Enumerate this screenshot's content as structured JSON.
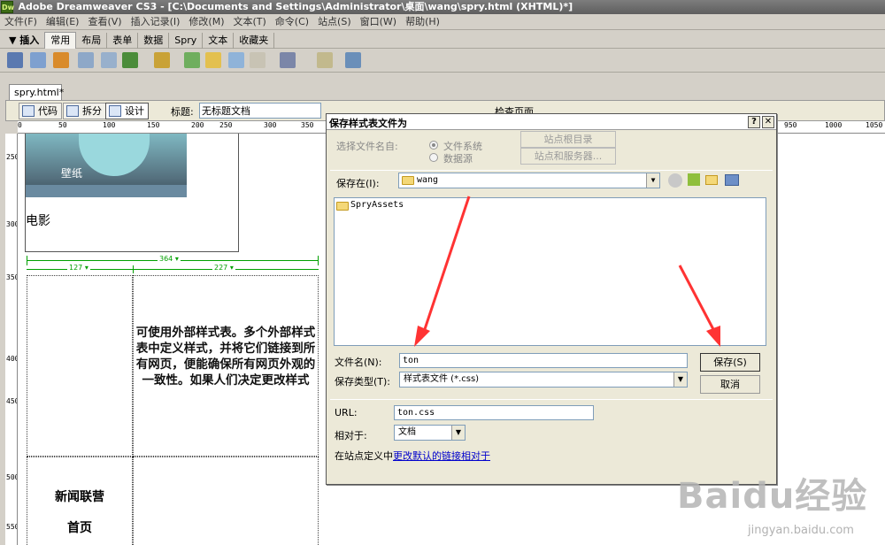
{
  "window": {
    "title": "Adobe Dreamweaver CS3 - [C:\\Documents and Settings\\Administrator\\桌面\\wang\\spry.html (XHTML)*]",
    "logo": "Dw"
  },
  "menu": [
    "文件(F)",
    "编辑(E)",
    "查看(V)",
    "插入记录(I)",
    "修改(M)",
    "文本(T)",
    "命令(C)",
    "站点(S)",
    "窗口(W)",
    "帮助(H)"
  ],
  "insert_bar": {
    "label": "▼ 插入",
    "tabs": [
      "常用",
      "布局",
      "表单",
      "数据",
      "Spry",
      "文本",
      "收藏夹"
    ],
    "active_tab": "常用"
  },
  "document": {
    "tab": "spry.html*",
    "toolbar": {
      "code": "代码",
      "split": "拆分",
      "design": "设计",
      "title_label": "标题:",
      "title_value": "无标题文档",
      "check_page": "检查页面"
    },
    "ruler_top": [
      "0",
      "50",
      "100",
      "150",
      "200",
      "250",
      "300",
      "350",
      "950",
      "1000",
      "1050"
    ],
    "ruler_left": [
      "250",
      "300",
      "350",
      "400",
      "450",
      "500",
      "550"
    ],
    "wallpaper": "壁纸",
    "movie": "电影",
    "table_width": "364 ▾",
    "col1_width": "127 ▾",
    "col2_width": "227 ▾",
    "cell_text": "可使用外部样式表。多个外部样式表中定义样式，并将它们链接到所有网页，便能确保所有网页外观的一致性。如果人们决定更改样式",
    "news": "新闻联营",
    "home": "首页"
  },
  "dialog": {
    "title": "保存样式表文件为",
    "help": "?",
    "close": "✕",
    "select_from_label": "选择文件名自:",
    "radio_filesystem": "文件系统",
    "radio_datasource": "数据源",
    "site_root_button": "站点根目录",
    "site_server_button": "站点和服务器...",
    "save_in_label": "保存在(I):",
    "save_in_value": "wang",
    "folders": [
      "SpryAssets"
    ],
    "filename_label": "文件名(N):",
    "filename_value": "ton",
    "filetype_label": "保存类型(T):",
    "filetype_value": "样式表文件 (*.css)",
    "save_button": "保存(S)",
    "cancel_button": "取消",
    "url_label": "URL:",
    "url_value": "ton.css",
    "relative_label": "相对于:",
    "relative_value": "文档",
    "site_def_text": "在站点定义中",
    "site_def_link": "更改默认的链接相对于"
  },
  "watermark": {
    "logo": "Baidu经验",
    "url": "jingyan.baidu.com"
  },
  "colors": {
    "annotation_arrow": "#ff3333",
    "width_guides": "#00a000",
    "link": "#0000cc"
  }
}
